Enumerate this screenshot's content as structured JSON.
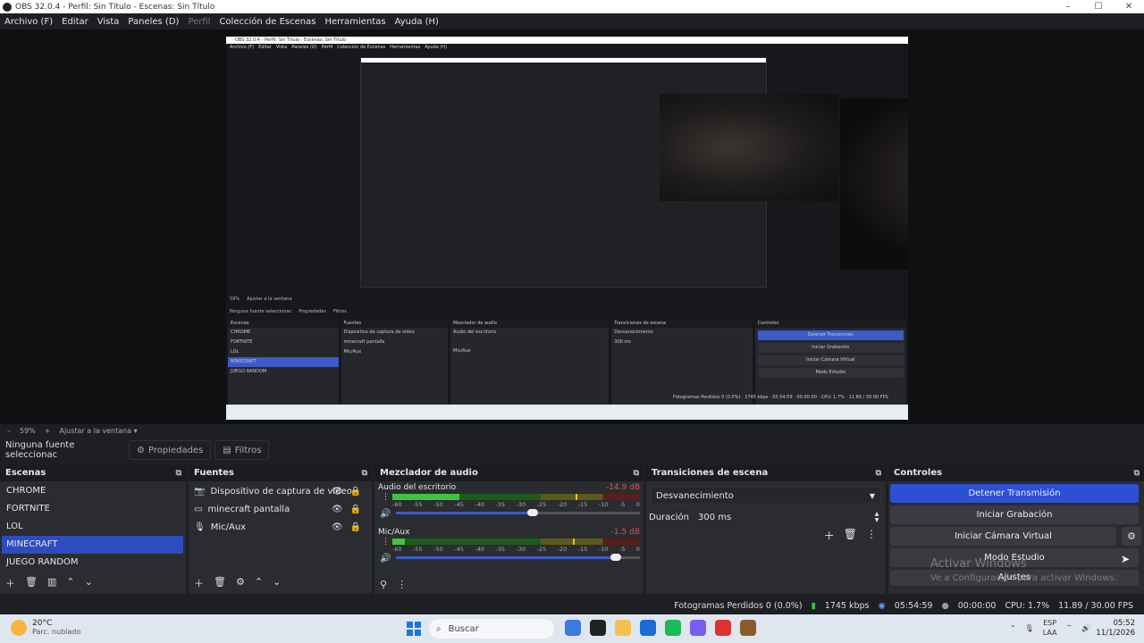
{
  "window": {
    "title": "OBS 32.0.4 - Perfil: Sin Título - Escenas: Sin Título",
    "controls": [
      "–",
      "☐",
      "✕"
    ]
  },
  "menu": [
    "Archivo (F)",
    "Editar",
    "Vista",
    "Paneles (D)",
    "Perfil",
    "Colección de Escenas",
    "Herramientas",
    "Ayuda (H)"
  ],
  "zoom": {
    "minus": "–",
    "value": "59%",
    "plus": "+",
    "fit": "Ajustar a la ventana"
  },
  "source_bar": {
    "no_source": "Ninguna fuente seleccionac",
    "properties": "Propiedades",
    "filters": "Filtros"
  },
  "scenes": {
    "title": "Escenas",
    "items": [
      "CHROME",
      "FORTNITE",
      "LOL",
      "MINECRAFT",
      "JUEGO RANDOM"
    ],
    "selected": "MINECRAFT"
  },
  "sources": {
    "title": "Fuentes",
    "items": [
      "Dispositivo de captura de video",
      "minecraft pantalla",
      "Mic/Aux"
    ]
  },
  "mixer": {
    "title": "Mezclador de audio",
    "channels": [
      {
        "name": "Audio del escritorio",
        "db": "-14.9 dB",
        "level": 0.27,
        "peak": 0.74,
        "fader": 0.56
      },
      {
        "name": "Mic/Aux",
        "db": "-1.5 dB",
        "level": 0.05,
        "peak": 0.73,
        "fader": 0.9
      }
    ],
    "ticks": [
      "-60",
      "-55",
      "-50",
      "-45",
      "-40",
      "-35",
      "-30",
      "-25",
      "-20",
      "-15",
      "-10",
      "-5",
      "0"
    ]
  },
  "transitions": {
    "title": "Transiciones de escena",
    "selected": "Desvanecimiento",
    "duration_label": "Duración",
    "duration_value": "300 ms"
  },
  "controls": {
    "title": "Controles",
    "stop_stream": "Detener Transmisión",
    "start_recording": "Iniciar Grabación",
    "start_virtual_cam": "Iniciar Cámara Virtual",
    "studio_mode": "Modo Estudio",
    "settings": "Ajustes"
  },
  "watermark": {
    "line1": "Activar Windows",
    "line2": "Ve a Configuración para activar Windows."
  },
  "status": {
    "dropped": "Fotogramas Perdidos 0 (0.0%)",
    "kbps": "1745 kbps",
    "live_time": "05:54:59",
    "rec_time": "00:00:00",
    "cpu": "CPU: 1.7%",
    "fps": "11.89 / 30.00 FPS"
  },
  "taskbar": {
    "weather_temp": "20°C",
    "weather_desc": "Parc. nublado",
    "search": "Buscar",
    "lang1": "ESP",
    "lang2": "LAA",
    "time": "05:52",
    "date": "11/1/2026",
    "icon_colors": [
      "#3a7be0",
      "#222",
      "#f2c14e",
      "#1e6bd6",
      "#1db954",
      "#7b5cf0",
      "#d33",
      "#8a5a2b"
    ]
  },
  "preview_nested": {
    "title": "OBS 32.0.4 - Perfil: Sin Título - Escenas: Sin Título",
    "menu": [
      "Archivo (F)",
      "Editar",
      "Vista",
      "Paneles (D)",
      "Perfil",
      "Colección de Escenas",
      "Herramientas",
      "Ayuda (H)"
    ],
    "zoom": "59%",
    "fit": "Ajustar a la ventana",
    "no_source": "Ninguna fuente seleccionac",
    "properties": "Propiedades",
    "filters": "Filtros",
    "dropped": "Fotogramas Perdidos 0 (0.0%)",
    "kbps": "1745 kbps",
    "live": "05:54:59",
    "rec": "00:00:00",
    "cpu": "CPU: 1.7%",
    "fps": "11.89 / 30.00 FPS"
  }
}
